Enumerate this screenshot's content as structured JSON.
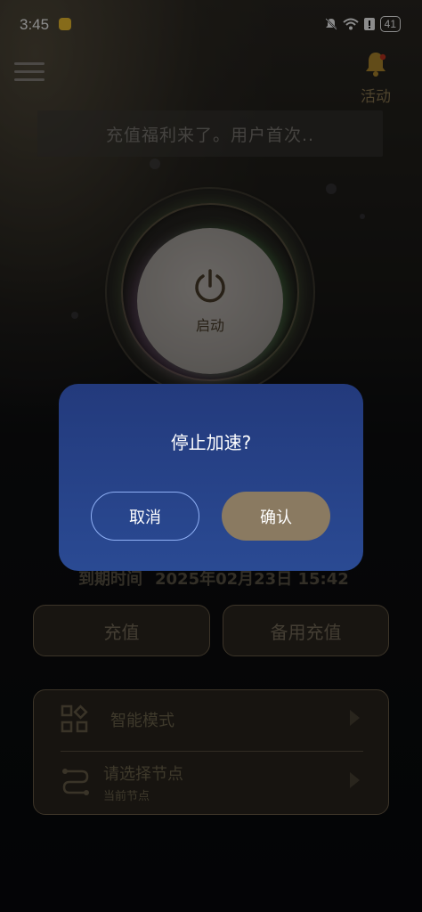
{
  "status_bar": {
    "time": "3:45",
    "battery": "41",
    "icons": [
      "app-badge-icon",
      "mute-icon",
      "wifi-icon",
      "alert-icon",
      "battery-icon"
    ]
  },
  "header": {
    "menu_icon": "hamburger-menu-icon",
    "activity_icon": "bell-icon",
    "activity_label": "活动"
  },
  "notice": {
    "text": "充值福利来了。用户首次.."
  },
  "power": {
    "icon": "power-icon",
    "label": "启动"
  },
  "expiry": {
    "label": "到期时间",
    "value": "2025年02月23日 15:42"
  },
  "buttons": {
    "recharge": "充值",
    "backup_recharge": "备用充值"
  },
  "panel": {
    "mode": {
      "icon": "grid-apps-icon",
      "label": "智能模式"
    },
    "node": {
      "icon": "route-icon",
      "label": "请选择节点",
      "sub": "当前节点"
    }
  },
  "dialog": {
    "title": "停止加速?",
    "cancel": "取消",
    "confirm": "确认"
  },
  "colors": {
    "dialog_bg": "#2a4a93",
    "accent_gold": "#8a7a61",
    "dialog_cancel_border": "#8fb0f5"
  }
}
